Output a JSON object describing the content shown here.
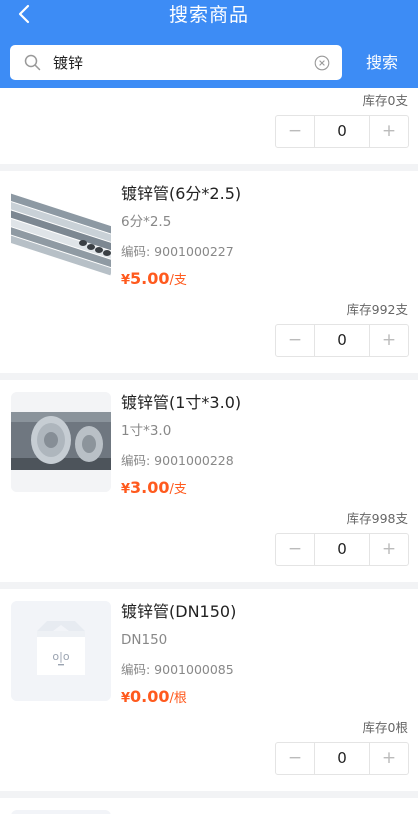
{
  "header": {
    "title": "搜索商品",
    "back_icon": "chevron-left-icon"
  },
  "search": {
    "value": "镀锌",
    "placeholder": "",
    "button_label": "搜索"
  },
  "products": [
    {
      "stock": "库存0支",
      "quantity": "0"
    },
    {
      "name": "镀锌管(6分*2.5)",
      "spec": "6分*2.5",
      "code": "编码: 9001000227",
      "currency": "¥",
      "price": "5.00",
      "unit": "/支",
      "stock": "库存992支",
      "quantity": "0",
      "image": "steel-pipes"
    },
    {
      "name": "镀锌管(1寸*3.0)",
      "spec": "1寸*3.0",
      "code": "编码: 9001000228",
      "currency": "¥",
      "price": "3.00",
      "unit": "/支",
      "stock": "库存998支",
      "quantity": "0",
      "image": "steel-coil"
    },
    {
      "name": "镀锌管(DN150)",
      "spec": "DN150",
      "code": "编码: 9001000085",
      "currency": "¥",
      "price": "0.00",
      "unit": "/根",
      "stock": "库存0根",
      "quantity": "0",
      "image": "placeholder-box"
    }
  ],
  "stepper": {
    "minus": "−",
    "plus": "+"
  },
  "colors": {
    "header": "#3d8cf5",
    "price": "#ff5a1e",
    "background": "#f2f3f5"
  }
}
